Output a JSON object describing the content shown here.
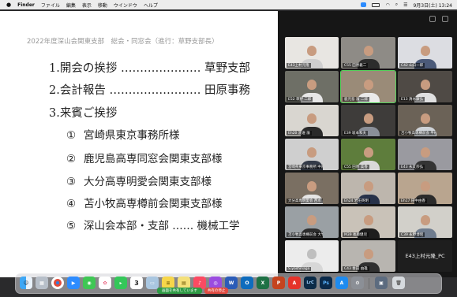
{
  "menubar": {
    "app": "Finder",
    "menus": [
      "ファイル",
      "編集",
      "表示",
      "移動",
      "ウインドウ",
      "ヘルプ"
    ],
    "clock": "9月3日(土) 13:24"
  },
  "slide": {
    "header": "2022年度深山会関東支部　総会・同窓会（進行：草野支部長）",
    "items": [
      {
        "num": "1.",
        "text": "開会の挨拶 ………………… 草野支部"
      },
      {
        "num": "2.",
        "text": "会計報告 …………………… 田原事務"
      },
      {
        "num": "3.",
        "text": "来賓ご挨拶"
      }
    ],
    "guests": [
      {
        "num": "①",
        "text": "宮崎県東京事務所様"
      },
      {
        "num": "②",
        "text": "鹿児島高専同窓会関東支部様"
      },
      {
        "num": "③",
        "text": "大分高専明愛会関東支部様"
      },
      {
        "num": "④",
        "text": "苫小牧高専樽前会関東支部様"
      },
      {
        "num": "⑤",
        "text": "深山会本部・支部 …… 機械工学"
      }
    ]
  },
  "gallery": {
    "tiles": [
      {
        "label": "E43上村元隆"
      },
      {
        "label": "C55 田原義二"
      },
      {
        "label": "C42 山口一郎"
      },
      {
        "label": "E52 草野 二郎"
      },
      {
        "label": "鹿児島 濱 二郎"
      },
      {
        "label": "E13 清水康弘"
      },
      {
        "label": "Eh20 渡邉 諭"
      },
      {
        "label": "E39 坂本和夫"
      },
      {
        "label": "苫小牧高専樽前会 平松"
      },
      {
        "label": "宮崎県東京事務所 中原"
      },
      {
        "label": "C55 田原 美香"
      },
      {
        "label": "E43 永友宗弘"
      },
      {
        "label": "大分高専明愛会 西水"
      },
      {
        "label": "Eh24 岩田英明"
      },
      {
        "label": "Eh17 田中由香"
      },
      {
        "label": "苫小牧高専樽前会 大竹"
      },
      {
        "label": "M39 後藤健児"
      },
      {
        "label": "C39 永野博昭"
      },
      {
        "label": "S.yoshinaga"
      },
      {
        "label": "C43 春田 由雄"
      },
      {
        "label": "E43上村元隆_PC"
      }
    ]
  },
  "share": {
    "status": "画面を共有しています",
    "stop": "共有の停止"
  },
  "dock": {
    "calendar_day": "3",
    "apps": [
      "Finder",
      "Launchpad",
      "Chrome",
      "Zoom",
      "Messages",
      "Photos",
      "FaceTime",
      "Calendar",
      "Preview",
      "Notes",
      "Stickies",
      "Music",
      "Podcasts",
      "Word",
      "Outlook",
      "Excel",
      "PowerPoint",
      "Acrobat",
      "Lightroom Classic",
      "Photoshop",
      "App Store",
      "System Preferences",
      "Screenshot",
      "Trash"
    ]
  },
  "colors": {
    "share_green": "#2e9b45",
    "stop_red": "#e14b42",
    "slide_text": "#222222",
    "header_gray": "#9a9a9a"
  }
}
